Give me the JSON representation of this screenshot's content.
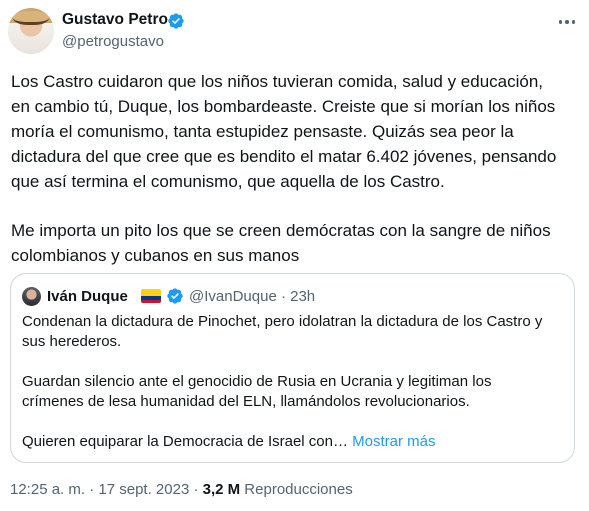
{
  "author": {
    "name": "Gustavo Petro",
    "handle": "@petrogustavo",
    "verified": true
  },
  "tweet": {
    "paragraph1": [
      "Los Castro cuidaron que los niños tuvieran comida, salud y educación,",
      "en cambio tú, Duque, los  bombardeaste. Creiste que si morían los niños",
      "moría el comunismo, tanta  estupidez pensaste. Quizás sea peor la",
      "dictadura del que cree que es bendito el matar 6.402 jóvenes, pensando",
      "que así termina el comunismo, que aquella de los Castro."
    ],
    "paragraph2": [
      "Me importa un pito los que se creen demócratas con la sangre de niños",
      "colombianos y cubanos en sus manos"
    ]
  },
  "quoted": {
    "name": "Iván Duque",
    "handle_time": "@IvanDuque · 23h",
    "verified": true,
    "paragraph1": [
      "Condenan la dictadura de Pinochet,  pero idolatran la dictadura de los Castro y",
      "sus herederos."
    ],
    "paragraph2": [
      "Guardan silencio ante el genocidio de Rusia en Ucrania y legitiman los",
      "crímenes de lesa humanidad del ELN, llamándolos revolucionarios."
    ],
    "paragraph3": "Quieren equiparar la Democracia de Israel con…",
    "show_more": "Mostrar más"
  },
  "meta": {
    "timestamp": "12:25 a. m. · 17 sept. 2023 · ",
    "views_count": "3,2 M",
    "views_label": " Reproducciones"
  },
  "colors": {
    "verified": "#1d9bf0",
    "link": "#1d9bf0",
    "secondary_text": "#536471",
    "border": "#cfd9de"
  },
  "icons": {
    "verified": "verified-badge-icon",
    "more": "more-horizontal-icon",
    "flag": "colombia-flag-icon"
  }
}
